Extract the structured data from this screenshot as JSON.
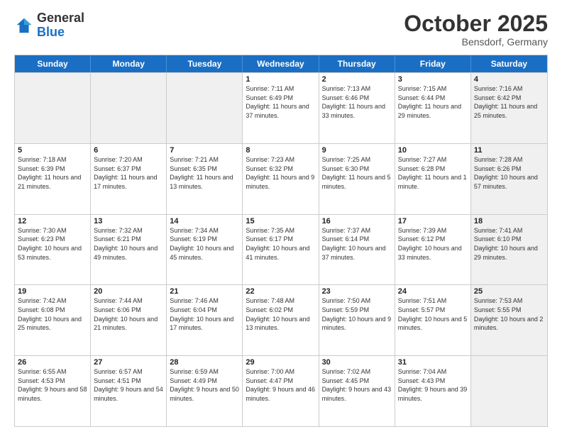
{
  "header": {
    "logo_general": "General",
    "logo_blue": "Blue",
    "month_title": "October 2025",
    "location": "Bensdorf, Germany"
  },
  "days_of_week": [
    "Sunday",
    "Monday",
    "Tuesday",
    "Wednesday",
    "Thursday",
    "Friday",
    "Saturday"
  ],
  "weeks": [
    [
      {
        "day": "",
        "info": "",
        "shaded": true
      },
      {
        "day": "",
        "info": "",
        "shaded": true
      },
      {
        "day": "",
        "info": "",
        "shaded": true
      },
      {
        "day": "1",
        "info": "Sunrise: 7:11 AM\nSunset: 6:49 PM\nDaylight: 11 hours and 37 minutes.",
        "shaded": false
      },
      {
        "day": "2",
        "info": "Sunrise: 7:13 AM\nSunset: 6:46 PM\nDaylight: 11 hours and 33 minutes.",
        "shaded": false
      },
      {
        "day": "3",
        "info": "Sunrise: 7:15 AM\nSunset: 6:44 PM\nDaylight: 11 hours and 29 minutes.",
        "shaded": false
      },
      {
        "day": "4",
        "info": "Sunrise: 7:16 AM\nSunset: 6:42 PM\nDaylight: 11 hours and 25 minutes.",
        "shaded": true
      }
    ],
    [
      {
        "day": "5",
        "info": "Sunrise: 7:18 AM\nSunset: 6:39 PM\nDaylight: 11 hours and 21 minutes.",
        "shaded": false
      },
      {
        "day": "6",
        "info": "Sunrise: 7:20 AM\nSunset: 6:37 PM\nDaylight: 11 hours and 17 minutes.",
        "shaded": false
      },
      {
        "day": "7",
        "info": "Sunrise: 7:21 AM\nSunset: 6:35 PM\nDaylight: 11 hours and 13 minutes.",
        "shaded": false
      },
      {
        "day": "8",
        "info": "Sunrise: 7:23 AM\nSunset: 6:32 PM\nDaylight: 11 hours and 9 minutes.",
        "shaded": false
      },
      {
        "day": "9",
        "info": "Sunrise: 7:25 AM\nSunset: 6:30 PM\nDaylight: 11 hours and 5 minutes.",
        "shaded": false
      },
      {
        "day": "10",
        "info": "Sunrise: 7:27 AM\nSunset: 6:28 PM\nDaylight: 11 hours and 1 minute.",
        "shaded": false
      },
      {
        "day": "11",
        "info": "Sunrise: 7:28 AM\nSunset: 6:26 PM\nDaylight: 10 hours and 57 minutes.",
        "shaded": true
      }
    ],
    [
      {
        "day": "12",
        "info": "Sunrise: 7:30 AM\nSunset: 6:23 PM\nDaylight: 10 hours and 53 minutes.",
        "shaded": false
      },
      {
        "day": "13",
        "info": "Sunrise: 7:32 AM\nSunset: 6:21 PM\nDaylight: 10 hours and 49 minutes.",
        "shaded": false
      },
      {
        "day": "14",
        "info": "Sunrise: 7:34 AM\nSunset: 6:19 PM\nDaylight: 10 hours and 45 minutes.",
        "shaded": false
      },
      {
        "day": "15",
        "info": "Sunrise: 7:35 AM\nSunset: 6:17 PM\nDaylight: 10 hours and 41 minutes.",
        "shaded": false
      },
      {
        "day": "16",
        "info": "Sunrise: 7:37 AM\nSunset: 6:14 PM\nDaylight: 10 hours and 37 minutes.",
        "shaded": false
      },
      {
        "day": "17",
        "info": "Sunrise: 7:39 AM\nSunset: 6:12 PM\nDaylight: 10 hours and 33 minutes.",
        "shaded": false
      },
      {
        "day": "18",
        "info": "Sunrise: 7:41 AM\nSunset: 6:10 PM\nDaylight: 10 hours and 29 minutes.",
        "shaded": true
      }
    ],
    [
      {
        "day": "19",
        "info": "Sunrise: 7:42 AM\nSunset: 6:08 PM\nDaylight: 10 hours and 25 minutes.",
        "shaded": false
      },
      {
        "day": "20",
        "info": "Sunrise: 7:44 AM\nSunset: 6:06 PM\nDaylight: 10 hours and 21 minutes.",
        "shaded": false
      },
      {
        "day": "21",
        "info": "Sunrise: 7:46 AM\nSunset: 6:04 PM\nDaylight: 10 hours and 17 minutes.",
        "shaded": false
      },
      {
        "day": "22",
        "info": "Sunrise: 7:48 AM\nSunset: 6:02 PM\nDaylight: 10 hours and 13 minutes.",
        "shaded": false
      },
      {
        "day": "23",
        "info": "Sunrise: 7:50 AM\nSunset: 5:59 PM\nDaylight: 10 hours and 9 minutes.",
        "shaded": false
      },
      {
        "day": "24",
        "info": "Sunrise: 7:51 AM\nSunset: 5:57 PM\nDaylight: 10 hours and 5 minutes.",
        "shaded": false
      },
      {
        "day": "25",
        "info": "Sunrise: 7:53 AM\nSunset: 5:55 PM\nDaylight: 10 hours and 2 minutes.",
        "shaded": true
      }
    ],
    [
      {
        "day": "26",
        "info": "Sunrise: 6:55 AM\nSunset: 4:53 PM\nDaylight: 9 hours and 58 minutes.",
        "shaded": false
      },
      {
        "day": "27",
        "info": "Sunrise: 6:57 AM\nSunset: 4:51 PM\nDaylight: 9 hours and 54 minutes.",
        "shaded": false
      },
      {
        "day": "28",
        "info": "Sunrise: 6:59 AM\nSunset: 4:49 PM\nDaylight: 9 hours and 50 minutes.",
        "shaded": false
      },
      {
        "day": "29",
        "info": "Sunrise: 7:00 AM\nSunset: 4:47 PM\nDaylight: 9 hours and 46 minutes.",
        "shaded": false
      },
      {
        "day": "30",
        "info": "Sunrise: 7:02 AM\nSunset: 4:45 PM\nDaylight: 9 hours and 43 minutes.",
        "shaded": false
      },
      {
        "day": "31",
        "info": "Sunrise: 7:04 AM\nSunset: 4:43 PM\nDaylight: 9 hours and 39 minutes.",
        "shaded": false
      },
      {
        "day": "",
        "info": "",
        "shaded": true
      }
    ]
  ]
}
